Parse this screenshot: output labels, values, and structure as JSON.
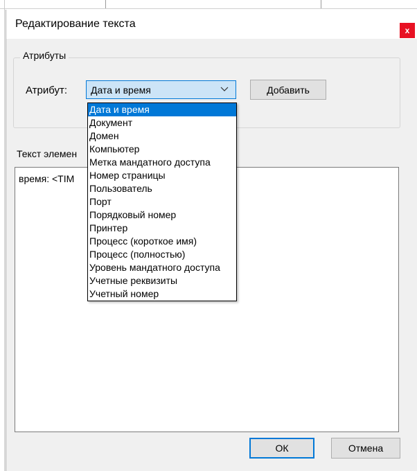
{
  "window": {
    "title": "Редактирование текста",
    "close_label": "x"
  },
  "attributes": {
    "group_title": "Атрибуты",
    "label": "Атрибут:",
    "selected": "Дата и время",
    "add_button": "Добавить"
  },
  "text_section": {
    "label": "Текст элемен",
    "content": "время: <TIM"
  },
  "dropdown": {
    "options": [
      "Дата и время",
      "Документ",
      "Домен",
      "Компьютер",
      "Метка мандатного доступа",
      "Номер страницы",
      "Пользователь",
      "Порт",
      "Порядковый номер",
      "Принтер",
      "Процесс (короткое имя)",
      "Процесс (полностью)",
      "Уровень мандатного доступа",
      "Учетные реквизиты",
      "Учетный номер"
    ],
    "selected_index": 0
  },
  "buttons": {
    "ok": "ОК",
    "cancel": "Отмена"
  },
  "colors": {
    "accent": "#0078d7",
    "close": "#e81123",
    "dialog_bg": "#f0f0f0"
  }
}
